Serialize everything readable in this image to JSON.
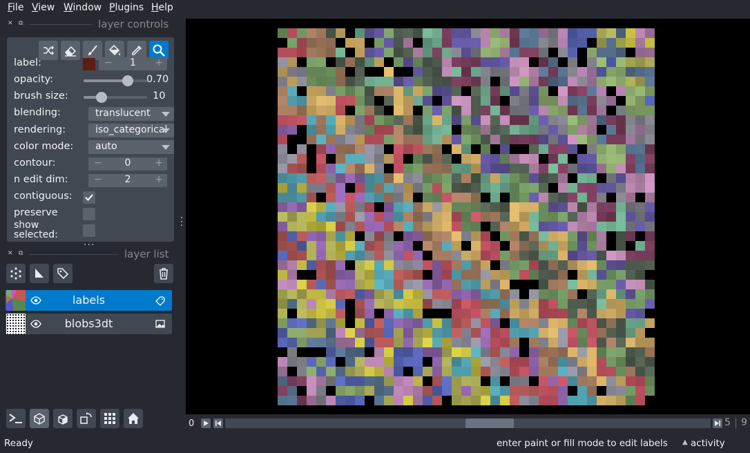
{
  "menu": [
    {
      "label": "File",
      "mnemonic_index": 0
    },
    {
      "label": "View",
      "mnemonic_index": 0
    },
    {
      "label": "Window",
      "mnemonic_index": 0
    },
    {
      "label": "Plugins",
      "mnemonic_index": 0
    },
    {
      "label": "Help",
      "mnemonic_index": 0
    }
  ],
  "layer_controls": {
    "title": "layer controls",
    "tools": [
      "shuffle-colors",
      "erase",
      "paint",
      "fill",
      "pick",
      "pan-zoom"
    ],
    "active_tool": "pan-zoom",
    "label": {
      "name": "label:",
      "value": "1",
      "swatch_color": "#5a1e14",
      "minus": "−",
      "plus": "+"
    },
    "opacity": {
      "name": "opacity:",
      "value": "0.70",
      "fraction": 0.7
    },
    "brush_size": {
      "name": "brush size:",
      "value": "10",
      "fraction": 0.28
    },
    "blending": {
      "name": "blending:",
      "value": "translucent"
    },
    "rendering": {
      "name": "rendering:",
      "value": "iso_categorical"
    },
    "color_mode": {
      "name": "color mode:",
      "value": "auto"
    },
    "contour": {
      "name": "contour:",
      "value": "0",
      "minus": "−",
      "plus": "+"
    },
    "n_edit_dim": {
      "name": "n edit dim:",
      "value": "2",
      "minus": "−",
      "plus": "+"
    },
    "contiguous": {
      "name": "contiguous:",
      "checked": true
    },
    "preserve": {
      "name": "preserve",
      "checked": false
    },
    "show_selected": {
      "name": "show selected:",
      "checked": false
    },
    "more": "..."
  },
  "layer_list": {
    "title": "layer list",
    "layers": [
      {
        "name": "labels",
        "selected": true,
        "visible": true,
        "type_icon": "label-tag-icon"
      },
      {
        "name": "blobs3dt",
        "selected": false,
        "visible": true,
        "type_icon": "image-icon"
      }
    ]
  },
  "dims": {
    "current": "0",
    "axis_size_a": "5",
    "axis_size_b": "9",
    "scroll_fraction": 0.55
  },
  "status": {
    "left": "Ready",
    "hint": "enter paint or fill mode to edit labels",
    "activity": "activity"
  },
  "colors": {
    "accent": "#007acc",
    "bg": "#262930",
    "panel": "#414851",
    "control": "#5a626c"
  }
}
